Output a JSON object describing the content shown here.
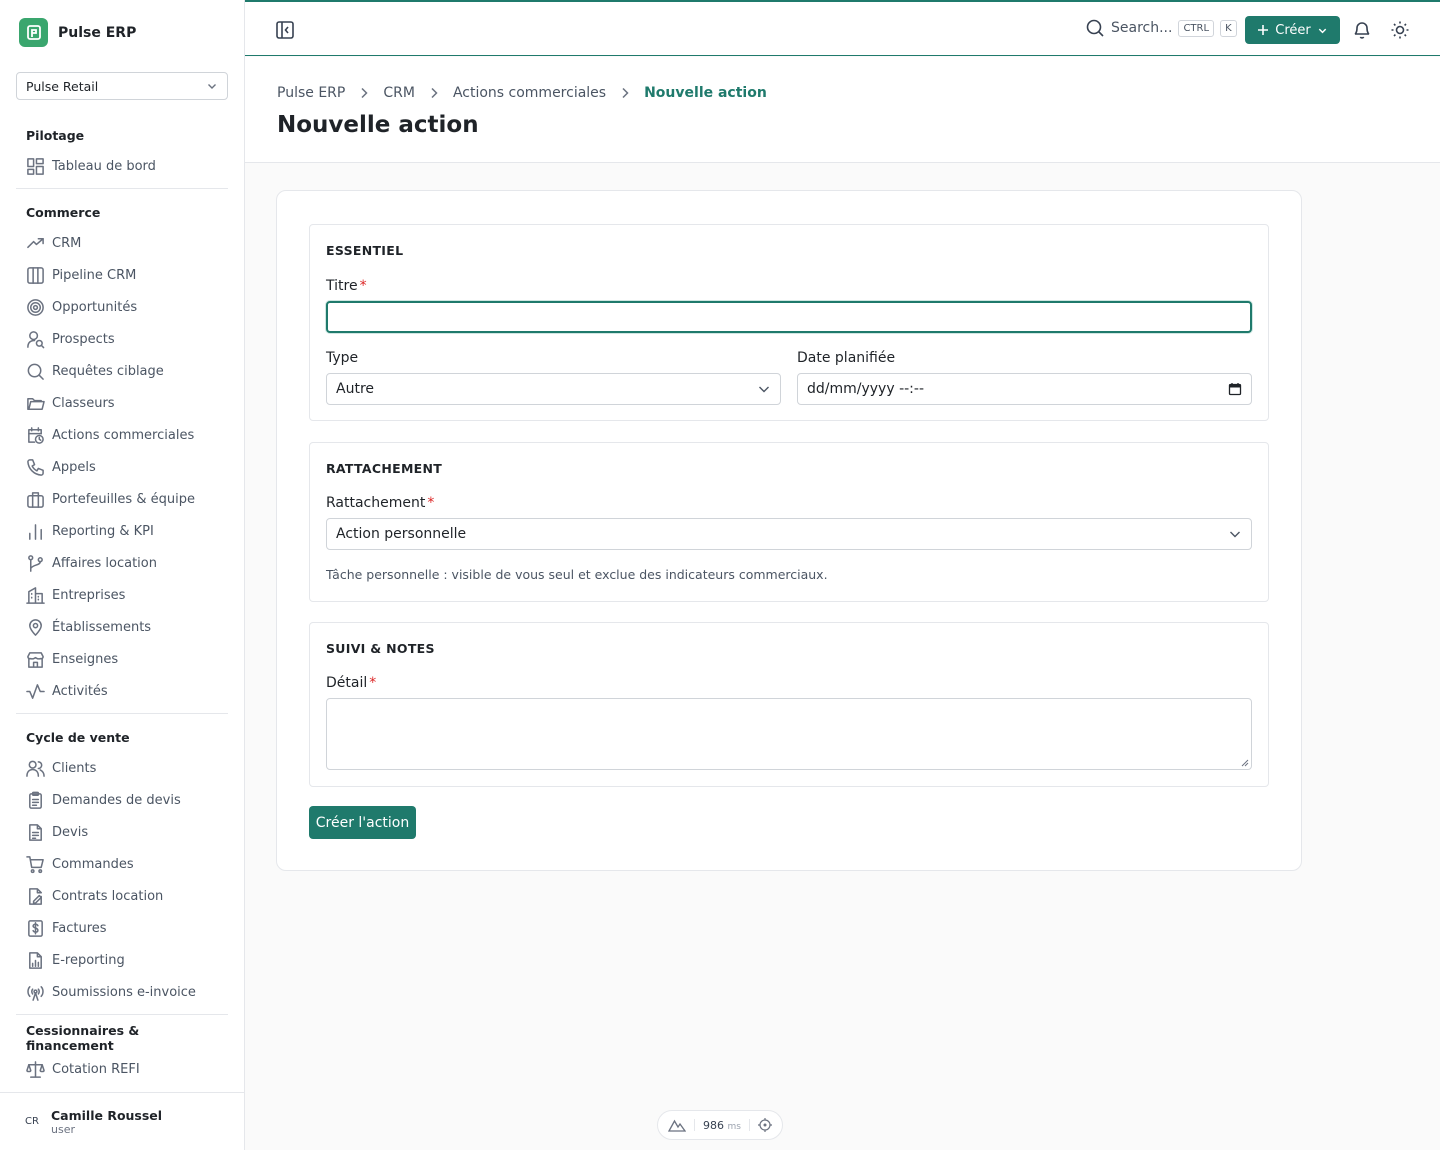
{
  "app": {
    "name": "Pulse ERP"
  },
  "org_select": {
    "value": "Pulse Retail"
  },
  "nav": {
    "groups": [
      {
        "title": "Pilotage",
        "items": [
          {
            "label": "Tableau de bord",
            "icon": "dashboard-icon"
          }
        ]
      },
      {
        "title": "Commerce",
        "items": [
          {
            "label": "CRM",
            "icon": "trending-up-icon"
          },
          {
            "label": "Pipeline CRM",
            "icon": "columns-icon"
          },
          {
            "label": "Opportunités",
            "icon": "target-icon"
          },
          {
            "label": "Prospects",
            "icon": "user-search-icon"
          },
          {
            "label": "Requêtes ciblage",
            "icon": "search-icon"
          },
          {
            "label": "Classeurs",
            "icon": "folder-icon"
          },
          {
            "label": "Actions commerciales",
            "icon": "calendar-clock-icon"
          },
          {
            "label": "Appels",
            "icon": "phone-icon"
          },
          {
            "label": "Portefeuilles & équipe",
            "icon": "briefcase-icon"
          },
          {
            "label": "Reporting & KPI",
            "icon": "bar-chart-icon"
          },
          {
            "label": "Affaires location",
            "icon": "git-branch-icon"
          },
          {
            "label": "Entreprises",
            "icon": "building-icon"
          },
          {
            "label": "Établissements",
            "icon": "map-pin-icon"
          },
          {
            "label": "Enseignes",
            "icon": "store-icon"
          },
          {
            "label": "Activités",
            "icon": "activity-icon"
          }
        ]
      },
      {
        "title": "Cycle de vente",
        "items": [
          {
            "label": "Clients",
            "icon": "users-icon"
          },
          {
            "label": "Demandes de devis",
            "icon": "clipboard-icon"
          },
          {
            "label": "Devis",
            "icon": "file-text-icon"
          },
          {
            "label": "Commandes",
            "icon": "cart-icon"
          },
          {
            "label": "Contrats location",
            "icon": "file-signature-icon"
          },
          {
            "label": "Factures",
            "icon": "invoice-dollar-icon"
          },
          {
            "label": "E-reporting",
            "icon": "file-chart-icon"
          },
          {
            "label": "Soumissions e-invoice",
            "icon": "radio-tower-icon"
          }
        ]
      },
      {
        "title": "Cessionnaires & financement",
        "items": [
          {
            "label": "Cotation REFI",
            "icon": "scale-icon"
          }
        ]
      }
    ]
  },
  "user": {
    "initials": "CR",
    "name": "Camille Roussel",
    "role": "user"
  },
  "topbar": {
    "search_label": "Search...",
    "kbd_ctrl": "CTRL",
    "kbd_k": "K",
    "create_label": "Créer"
  },
  "breadcrumb": [
    "Pulse ERP",
    "CRM",
    "Actions commerciales",
    "Nouvelle action"
  ],
  "page_title": "Nouvelle action",
  "form": {
    "essentials": {
      "title": "ESSENTIEL",
      "titre_label": "Titre",
      "titre_value": "",
      "type_label": "Type",
      "type_value": "Autre",
      "date_label": "Date planifiée",
      "date_placeholder": "dd/mm/yyyy --:--"
    },
    "attachment": {
      "title": "RATTACHEMENT",
      "label": "Rattachement",
      "value": "Action personnelle",
      "hint": "Tâche personnelle : visible de vous seul et exclue des indicateurs commerciaux."
    },
    "notes": {
      "title": "SUIVI & NOTES",
      "detail_label": "Détail",
      "detail_value": ""
    },
    "required_mark": "*",
    "submit_label": "Créer l'action"
  },
  "perf": {
    "value": "986",
    "unit": "ms"
  },
  "colors": {
    "accent": "#1f7a6c",
    "required": "#dc2626",
    "brand_logo": "#3aa66e"
  }
}
